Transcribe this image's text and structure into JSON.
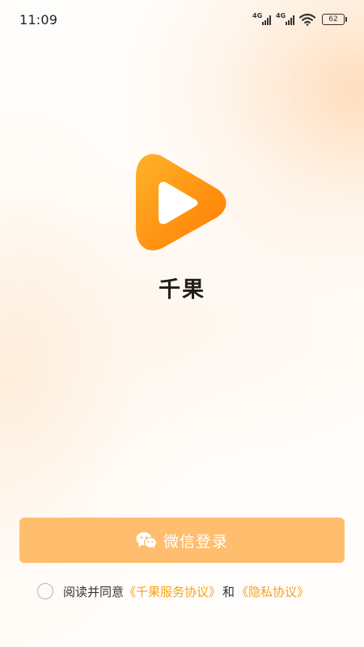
{
  "status_bar": {
    "time": "11:09",
    "sim1_tag": "4G",
    "sim2_tag": "4G",
    "battery_level": "62"
  },
  "app": {
    "name": "千果",
    "logo_icon": "play-icon",
    "brand_color": "#ff8a00"
  },
  "login": {
    "button_label": "微信登录",
    "button_icon": "wechat-icon",
    "button_color": "#ffbd6e"
  },
  "agreement": {
    "checked": false,
    "prefix": "阅读并同意",
    "terms_link": "《千果服务协议》",
    "conjunction": "和",
    "privacy_link": "《隐私协议》",
    "link_color": "#f7a21b"
  }
}
